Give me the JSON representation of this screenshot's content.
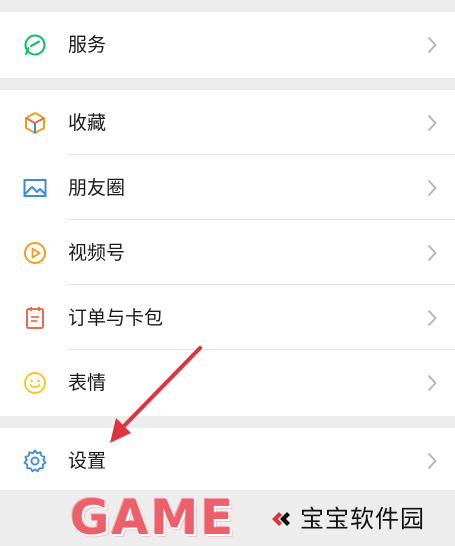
{
  "menu": {
    "service": {
      "label": "服务",
      "icon": "service-icon"
    },
    "items": [
      {
        "label": "收藏",
        "icon": "favorites-cube-icon"
      },
      {
        "label": "朋友圈",
        "icon": "moments-image-icon"
      },
      {
        "label": "视频号",
        "icon": "channels-play-icon"
      },
      {
        "label": "订单与卡包",
        "icon": "orders-cards-icon"
      },
      {
        "label": "表情",
        "icon": "stickers-smile-icon"
      }
    ],
    "settings": {
      "label": "设置",
      "icon": "gear-icon"
    }
  },
  "annotation": {
    "arrow_color": "#e0343c",
    "points_to": "settings"
  },
  "watermark": {
    "game_text": "GAME",
    "site_name": "宝宝软件园"
  },
  "colors": {
    "background": "#ededed",
    "row": "#ffffff",
    "service_icon": "#07c160",
    "favorites_icon": "#f0a020",
    "moments_icon": "#3d8bd8",
    "channels_icon": "#f0a020",
    "orders_icon": "#f06a4a",
    "stickers_icon": "#f7c52b",
    "settings_icon": "#3d8bd8"
  }
}
